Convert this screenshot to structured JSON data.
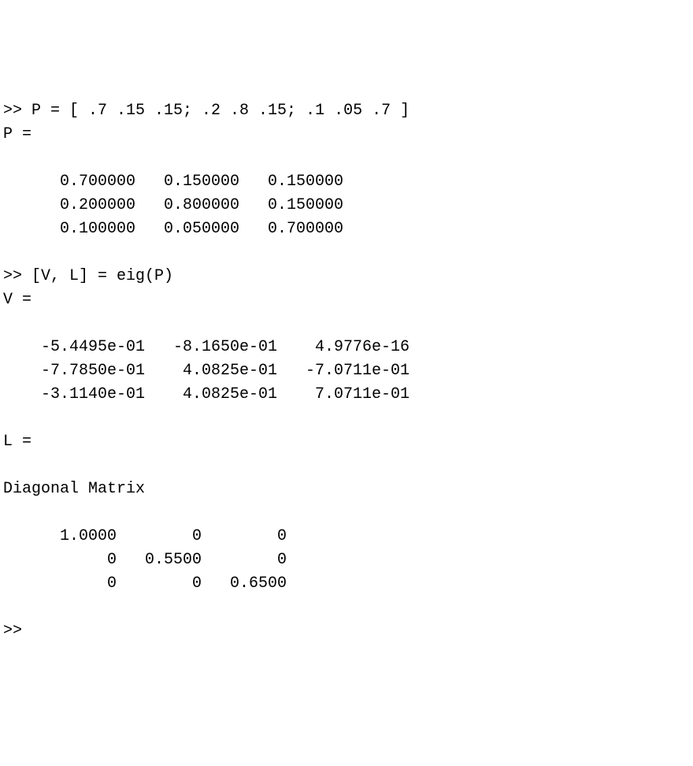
{
  "prompt": ">>",
  "lines": {
    "cmd1": ">> P = [ .7 .15 .15; .2 .8 .15; .1 .05 .7 ]",
    "echoP": "P =",
    "cmd2": ">> [V, L] = eig(P)",
    "echoV": "V =",
    "echoL": "L =",
    "diag": "Diagonal Matrix",
    "finalPrompt": ">>"
  },
  "matrixP": [
    [
      "0.700000",
      "0.150000",
      "0.150000"
    ],
    [
      "0.200000",
      "0.800000",
      "0.150000"
    ],
    [
      "0.100000",
      "0.050000",
      "0.700000"
    ]
  ],
  "matrixV": [
    [
      "-5.4495e-01",
      "-8.1650e-01",
      "4.9776e-16"
    ],
    [
      "-7.7850e-01",
      "4.0825e-01",
      "-7.0711e-01"
    ],
    [
      "-3.1140e-01",
      "4.0825e-01",
      "7.0711e-01"
    ]
  ],
  "matrixL": [
    [
      "1.0000",
      "0",
      "0"
    ],
    [
      "0",
      "0.5500",
      "0"
    ],
    [
      "0",
      "0",
      "0.6500"
    ]
  ]
}
